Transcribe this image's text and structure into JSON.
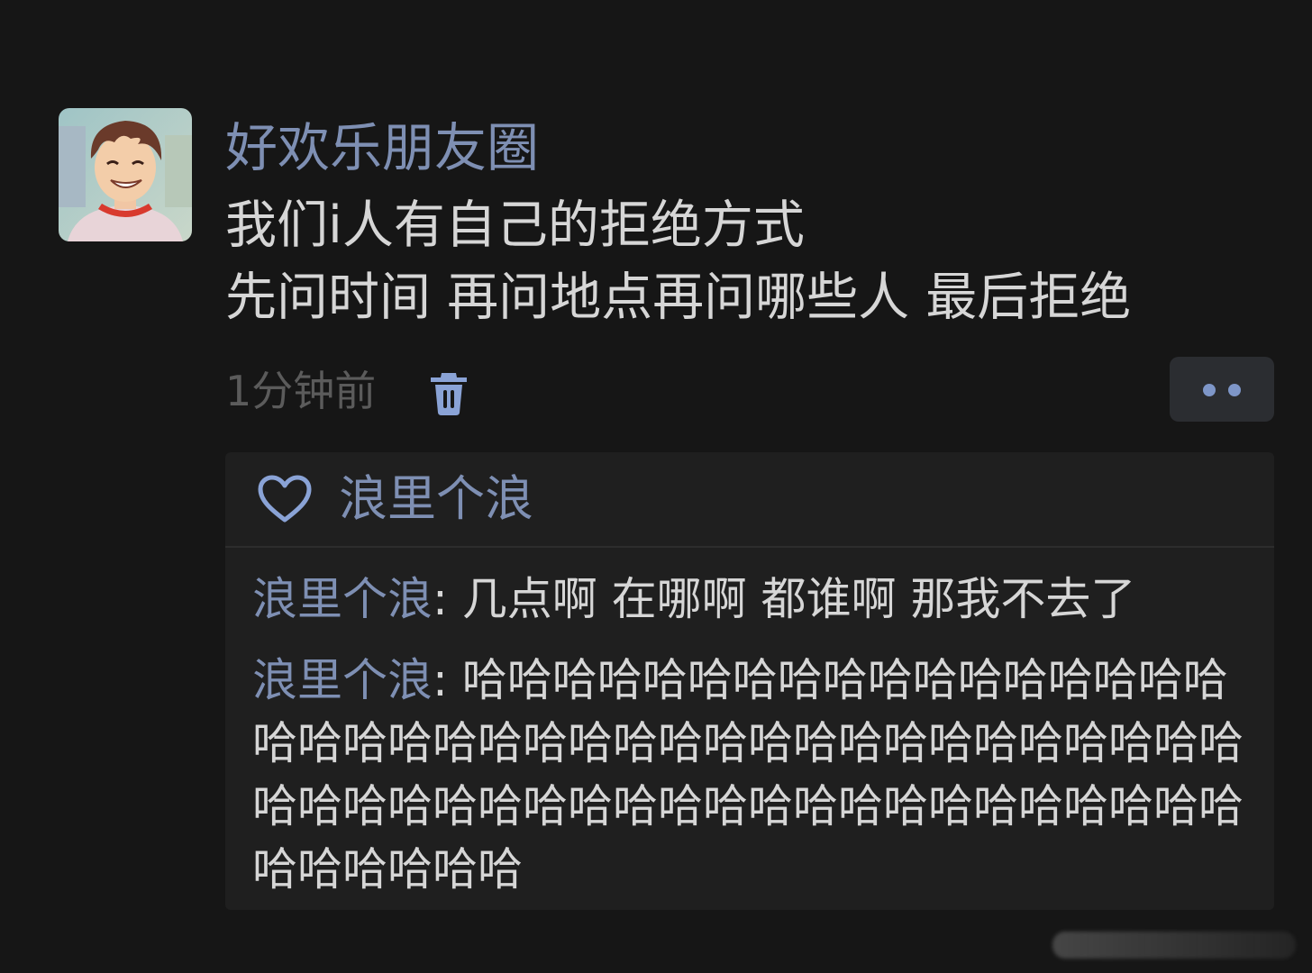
{
  "post": {
    "author": "好欢乐朋友圈",
    "lines": [
      "我们i人有自己的拒绝方式",
      "先问时间 再问地点再问哪些人 最后拒绝"
    ],
    "time": "1分钟前"
  },
  "likes": {
    "names": "浪里个浪"
  },
  "comments": [
    {
      "author": "浪里个浪",
      "separator": ": ",
      "text": "几点啊 在哪啊 都谁啊 那我不去了"
    },
    {
      "author": "浪里个浪",
      "separator": ": ",
      "text": "哈哈哈哈哈哈哈哈哈哈哈哈哈哈哈哈哈哈哈哈哈哈哈哈哈哈哈哈哈哈哈哈哈哈哈哈哈哈哈哈哈哈哈哈哈哈哈哈哈哈哈哈哈哈哈哈哈哈哈哈哈哈哈哈哈哈哈"
    }
  ],
  "icons": {
    "delete": "trash-icon",
    "more": "more-dots-icon",
    "like": "heart-icon"
  },
  "colors": {
    "background": "#161616",
    "name_accent": "#7e8fb3",
    "body_text": "#d6d6d6",
    "muted_text": "#5b5b5b",
    "panel": "#1f1f1f",
    "button": "#2b2d31",
    "dots": "#7e96c8"
  }
}
